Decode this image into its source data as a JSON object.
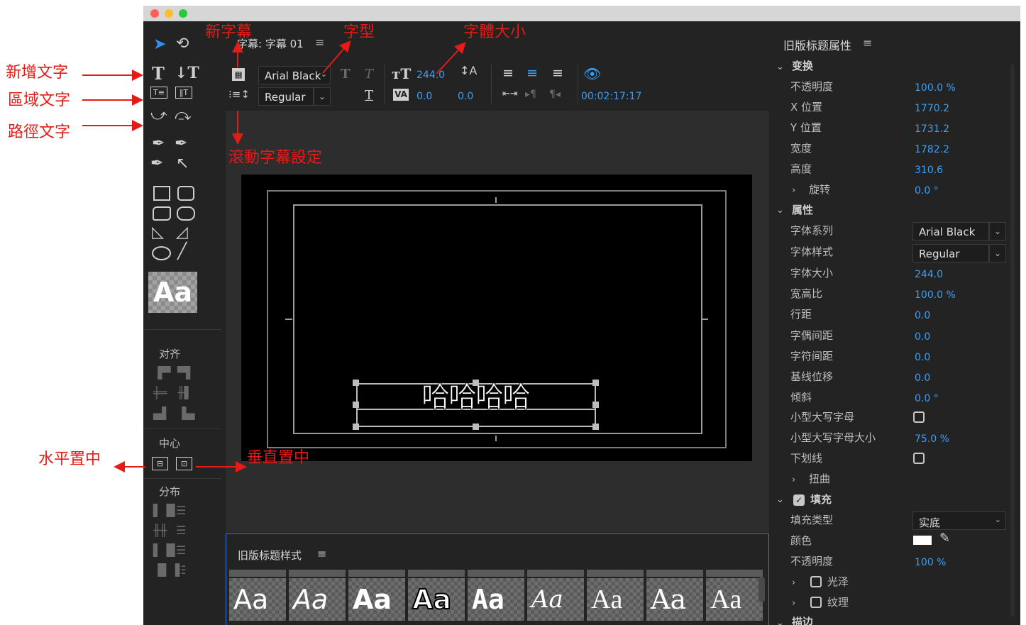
{
  "window": {
    "title_tab": "字幕: 字幕 01",
    "menu_glyph": "≡"
  },
  "toolbar": {
    "font_family": "Arial Black",
    "font_style": "Regular",
    "font_size": "244.0",
    "kerning": "0.0",
    "leading": "0.0",
    "timecode": "00:02:17:17"
  },
  "tools": {
    "align_label": "对齐",
    "center_label": "中心",
    "distribute_label": "分布",
    "style_preview": "Aa"
  },
  "canvas": {
    "text": "哈哈哈哈"
  },
  "properties": {
    "panel_title": "旧版标题属性",
    "transform": {
      "section": "变换",
      "rows": [
        {
          "label": "不透明度",
          "value": "100.0 %"
        },
        {
          "label": "X 位置",
          "value": "1770.2"
        },
        {
          "label": "Y 位置",
          "value": "1731.2"
        },
        {
          "label": "宽度",
          "value": "1782.2"
        },
        {
          "label": "高度",
          "value": "310.6"
        },
        {
          "label": "旋转",
          "value": "0.0 °"
        }
      ]
    },
    "attributes": {
      "section": "属性",
      "font_family_label": "字体系列",
      "font_family": "Arial Black",
      "font_style_label": "字体样式",
      "font_style": "Regular",
      "rows": [
        {
          "label": "字体大小",
          "value": "244.0"
        },
        {
          "label": "宽高比",
          "value": "100.0 %"
        },
        {
          "label": "行距",
          "value": "0.0"
        },
        {
          "label": "字偶间距",
          "value": "0.0"
        },
        {
          "label": "字符间距",
          "value": "0.0"
        },
        {
          "label": "基线位移",
          "value": "0.0"
        },
        {
          "label": "倾斜",
          "value": "0.0 °"
        }
      ],
      "small_caps_label": "小型大写字母",
      "small_caps_size_label": "小型大写字母大小",
      "small_caps_size": "75.0 %",
      "underline_label": "下划线",
      "distort_label": "扭曲"
    },
    "fill": {
      "section": "填充",
      "type_label": "填充类型",
      "type_value": "实底",
      "color_label": "颜色",
      "color_value": "#ffffff",
      "opacity_label": "不透明度",
      "opacity_value": "100 %",
      "sheen_label": "光泽",
      "texture_label": "纹理"
    },
    "stroke_label": "描边"
  },
  "styles_panel": {
    "title": "旧版标题样式",
    "swatch_text": "Aa"
  },
  "annotations": {
    "new_title": "新字幕",
    "font": "字型",
    "font_size": "字體大小",
    "add_text": "新增文字",
    "area_text": "區域文字",
    "path_text": "路徑文字",
    "roll_crawl": "滾動字幕設定",
    "center_h": "水平置中",
    "center_v": "垂直置中",
    "color": "#e41b17"
  }
}
